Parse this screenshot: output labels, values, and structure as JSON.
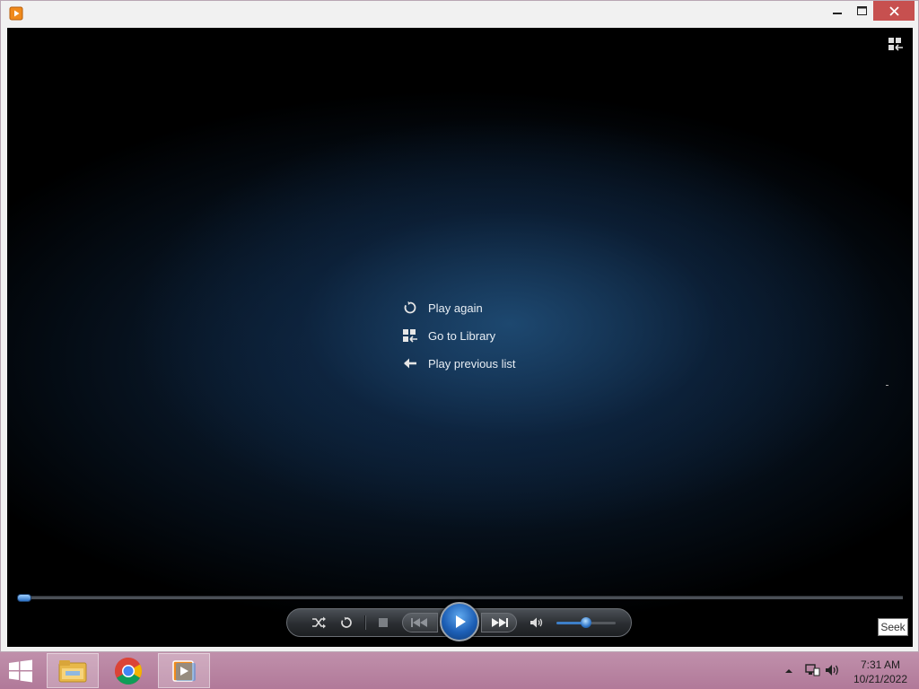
{
  "window": {
    "app_icon": "media-player-icon"
  },
  "titlebar_buttons": {
    "minimize": "minimize-icon",
    "maximize": "maximize-icon",
    "close": "close-icon"
  },
  "video": {
    "switch_icon": "switch-to-library-icon",
    "menu": [
      {
        "label": "Play again",
        "icon": "replay-icon"
      },
      {
        "label": "Go to Library",
        "icon": "library-icon"
      },
      {
        "label": "Play previous list",
        "icon": "back-arrow-icon"
      }
    ]
  },
  "seek": {
    "position_fraction": 0.005,
    "tooltip": "Seek"
  },
  "controls": {
    "volume_fraction": 0.5
  },
  "taskbar": {
    "clock_time": "7:31 AM",
    "clock_date": "10/21/2022"
  },
  "colors": {
    "accent": "#2b6fc4",
    "taskbar": "#b57c9c",
    "close": "#c7504f"
  }
}
